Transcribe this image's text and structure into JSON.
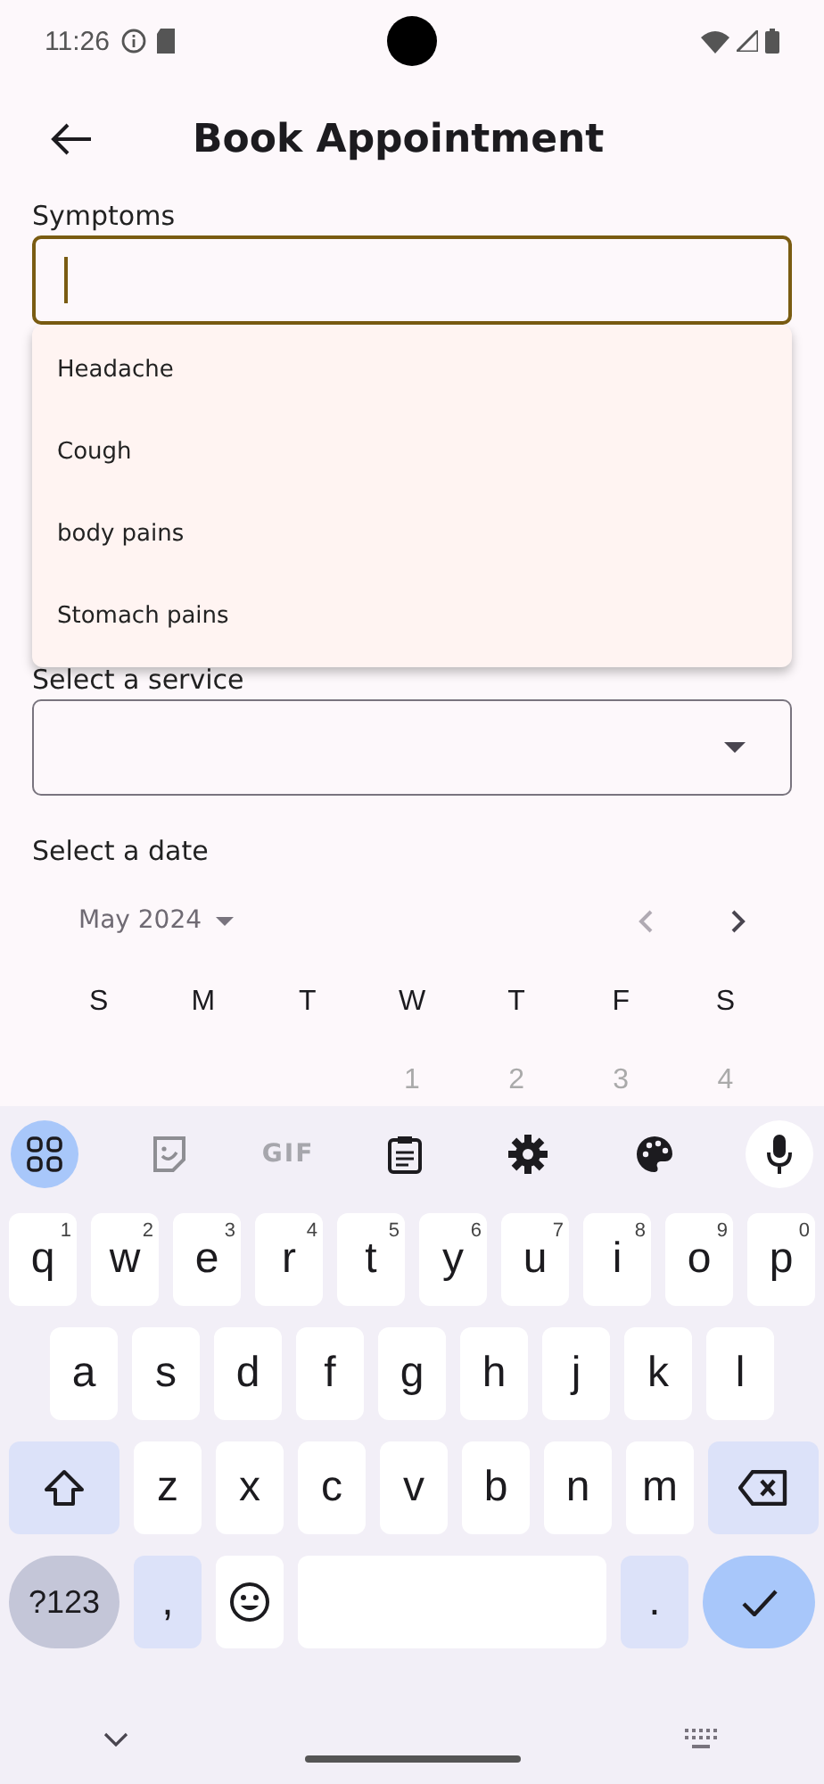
{
  "status_bar": {
    "time": "11:26"
  },
  "header": {
    "title": "Book Appointment"
  },
  "symptoms": {
    "label": "Symptoms",
    "focused": true,
    "suggestions": [
      "Headache",
      "Cough",
      "body pains",
      "Stomach pains"
    ]
  },
  "service": {
    "label": "Select a service"
  },
  "date": {
    "label": "Select a date",
    "month": "May 2024",
    "prev_disabled": true,
    "next_disabled": false,
    "weekdays": [
      "S",
      "M",
      "T",
      "W",
      "T",
      "F",
      "S"
    ],
    "first_week": [
      "1",
      "2",
      "3",
      "4"
    ]
  },
  "keyboard": {
    "toolbar_text": "GIF",
    "rows": [
      {
        "keys": [
          {
            "kind": "char",
            "label": "q",
            "hint": "1"
          },
          {
            "kind": "char",
            "label": "w",
            "hint": "2"
          },
          {
            "kind": "char",
            "label": "e",
            "hint": "3"
          },
          {
            "kind": "char",
            "label": "r",
            "hint": "4"
          },
          {
            "kind": "char",
            "label": "t",
            "hint": "5"
          },
          {
            "kind": "char",
            "label": "y",
            "hint": "6"
          },
          {
            "kind": "char",
            "label": "u",
            "hint": "7"
          },
          {
            "kind": "char",
            "label": "i",
            "hint": "8"
          },
          {
            "kind": "char",
            "label": "o",
            "hint": "9"
          },
          {
            "kind": "char",
            "label": "p",
            "hint": "0"
          }
        ]
      },
      {
        "keys": [
          {
            "kind": "char",
            "label": "a"
          },
          {
            "kind": "char",
            "label": "s"
          },
          {
            "kind": "char",
            "label": "d"
          },
          {
            "kind": "char",
            "label": "f"
          },
          {
            "kind": "char",
            "label": "g"
          },
          {
            "kind": "char",
            "label": "h"
          },
          {
            "kind": "char",
            "label": "j"
          },
          {
            "kind": "char",
            "label": "k"
          },
          {
            "kind": "char",
            "label": "l"
          }
        ]
      },
      {
        "keys": [
          {
            "kind": "shift"
          },
          {
            "kind": "char",
            "label": "z"
          },
          {
            "kind": "char",
            "label": "x"
          },
          {
            "kind": "char",
            "label": "c"
          },
          {
            "kind": "char",
            "label": "v"
          },
          {
            "kind": "char",
            "label": "b"
          },
          {
            "kind": "char",
            "label": "n"
          },
          {
            "kind": "char",
            "label": "m"
          },
          {
            "kind": "backspace"
          }
        ]
      },
      {
        "keys": [
          {
            "kind": "symbols",
            "label": "?123"
          },
          {
            "kind": "punct",
            "label": ","
          },
          {
            "kind": "emoji"
          },
          {
            "kind": "space"
          },
          {
            "kind": "punct",
            "label": "."
          },
          {
            "kind": "enter"
          }
        ]
      }
    ]
  }
}
